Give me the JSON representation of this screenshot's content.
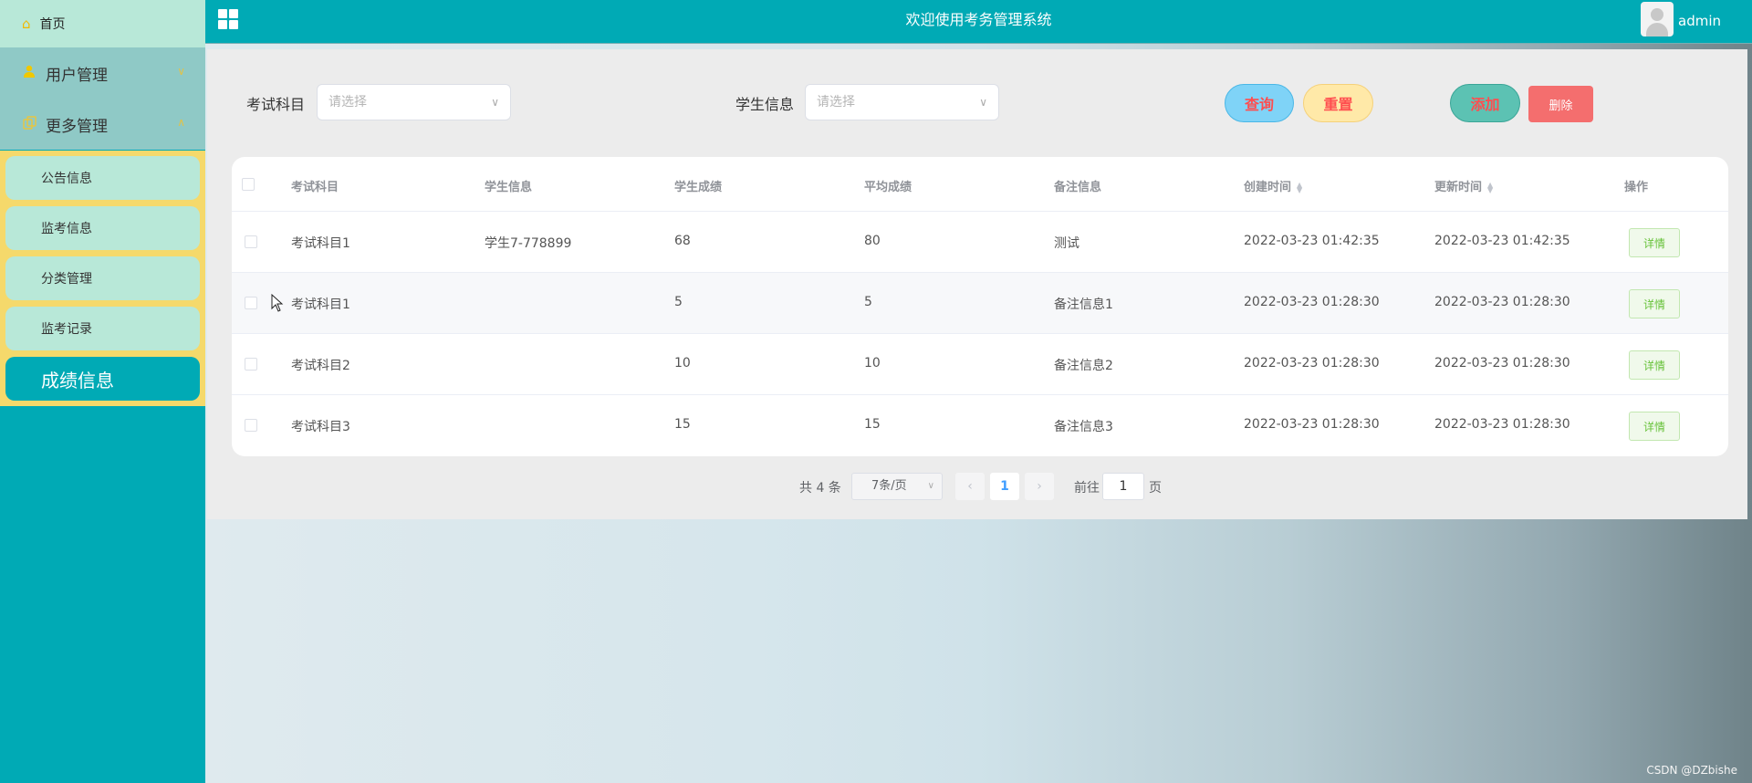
{
  "header": {
    "title": "欢迎使用考务管理系统",
    "user_name": "admin"
  },
  "sidebar": {
    "home_label": "首页",
    "groups": [
      {
        "label": "用户管理"
      },
      {
        "label": "更多管理"
      }
    ],
    "sub_items": [
      {
        "label": "公告信息"
      },
      {
        "label": "监考信息"
      },
      {
        "label": "分类管理"
      },
      {
        "label": "监考记录"
      },
      {
        "label": "成绩信息"
      }
    ]
  },
  "filters": {
    "subject_label": "考试科目",
    "subject_placeholder": "请选择",
    "student_label": "学生信息",
    "student_placeholder": "请选择"
  },
  "actions": {
    "query": "查询",
    "reset": "重置",
    "add": "添加",
    "delete": "删除"
  },
  "table": {
    "columns": [
      "考试科目",
      "学生信息",
      "学生成绩",
      "平均成绩",
      "备注信息",
      "创建时间",
      "更新时间",
      "操作"
    ],
    "rows": [
      {
        "subject": "考试科目1",
        "student": "学生7-778899",
        "score": "68",
        "average": "80",
        "remark": "测试",
        "created": "2022-03-23 01:42:35",
        "updated": "2022-03-23 01:42:35",
        "action": "详情"
      },
      {
        "subject": "考试科目1",
        "student": "",
        "score": "5",
        "average": "5",
        "remark": "备注信息1",
        "created": "2022-03-23 01:28:30",
        "updated": "2022-03-23 01:28:30",
        "action": "详情"
      },
      {
        "subject": "考试科目2",
        "student": "",
        "score": "10",
        "average": "10",
        "remark": "备注信息2",
        "created": "2022-03-23 01:28:30",
        "updated": "2022-03-23 01:28:30",
        "action": "详情"
      },
      {
        "subject": "考试科目3",
        "student": "",
        "score": "15",
        "average": "15",
        "remark": "备注信息3",
        "created": "2022-03-23 01:28:30",
        "updated": "2022-03-23 01:28:30",
        "action": "详情"
      }
    ]
  },
  "pagination": {
    "total": "共 4 条",
    "page_size": "7条/页",
    "current_page": "1",
    "goto_label": "前往",
    "goto_value": "1",
    "page_suffix": "页"
  },
  "watermark": "CSDN @DZbishe",
  "icons": {
    "home": "home-icon",
    "user": "user-icon",
    "more": "copy-icon",
    "menu": "grid-icon"
  },
  "colors": {
    "primary": "#00aab5",
    "submenu_bg": "#f5d96b",
    "menu_item": "#b8e8d8",
    "danger_text": "#ff4d4f",
    "delete_btn": "#f46e6e",
    "detail_text": "#67c23a"
  }
}
